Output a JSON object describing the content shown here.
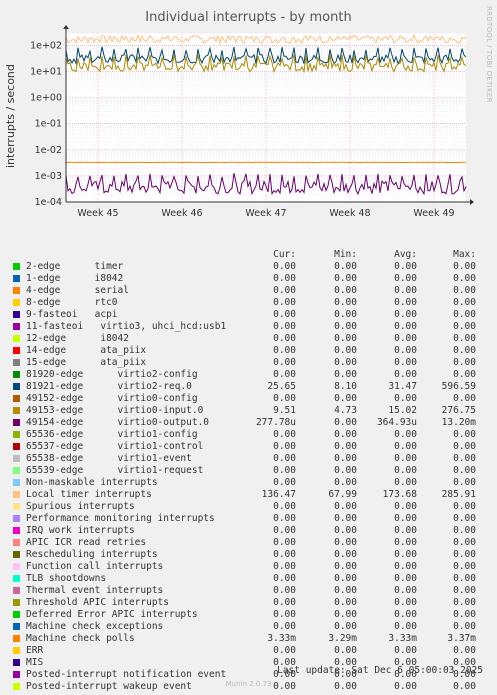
{
  "title": "Individual interrupts - by month",
  "side_label": "RRDTOOL / TOBI OETIKER",
  "colors": {
    "background": "#f0f0f0",
    "plot_bg": "#ffffff",
    "grid_major": "#e6a0a0",
    "grid_minor": "#d8d8f0"
  },
  "chart_data": {
    "type": "line",
    "ylabel": "interrupts / second",
    "yscale": "log",
    "ylim": [
      0.0001,
      300
    ],
    "yticks": [
      "1e+02",
      "1e+01",
      "1e+00",
      "1e-01",
      "1e-02",
      "1e-03",
      "1e-04"
    ],
    "xticks": [
      "Week 45",
      "Week 46",
      "Week 47",
      "Week 48",
      "Week 49"
    ],
    "series": [
      {
        "name": "Local timer interrupts",
        "color": "#ffc080",
        "base": 170,
        "spread": 0.3,
        "spike": 250
      },
      {
        "name": "49154-edge",
        "color": "#660066",
        "base": 0.000365,
        "spread": 0.5,
        "spike": 0.0013
      },
      {
        "name": "81921-edge",
        "color": "#004466",
        "base": 30,
        "spread": 0.35,
        "spike": 90
      },
      {
        "name": "49153-edge",
        "color": "#aa8800",
        "base": 15,
        "spread": 0.35,
        "spike": 45
      },
      {
        "name": "Machine check polls",
        "color": "#ee8800",
        "base": 0.0033,
        "spread": 0.01,
        "spike": 0.0034
      }
    ]
  },
  "legend": {
    "headers": [
      "Cur:",
      "Min:",
      "Avg:",
      "Max:"
    ],
    "rows": [
      {
        "name": "2-edge      timer",
        "color": "#00cc00",
        "cur": "0.00",
        "min": "0.00",
        "avg": "0.00",
        "max": "0.00"
      },
      {
        "name": "1-edge      i8042",
        "color": "#0066b3",
        "cur": "0.00",
        "min": "0.00",
        "avg": "0.00",
        "max": "0.00"
      },
      {
        "name": "4-edge      serial",
        "color": "#ff8000",
        "cur": "0.00",
        "min": "0.00",
        "avg": "0.00",
        "max": "0.00"
      },
      {
        "name": "8-edge      rtc0",
        "color": "#ffcc00",
        "cur": "0.00",
        "min": "0.00",
        "avg": "0.00",
        "max": "0.00"
      },
      {
        "name": "9-fasteoi   acpi",
        "color": "#330099",
        "cur": "0.00",
        "min": "0.00",
        "avg": "0.00",
        "max": "0.00"
      },
      {
        "name": "11-fasteoi   virtio3, uhci_hcd:usb1",
        "color": "#990099",
        "cur": "0.00",
        "min": "0.00",
        "avg": "0.00",
        "max": "0.00"
      },
      {
        "name": "12-edge      i8042",
        "color": "#ccff00",
        "cur": "0.00",
        "min": "0.00",
        "avg": "0.00",
        "max": "0.00"
      },
      {
        "name": "14-edge      ata_piix",
        "color": "#ff0000",
        "cur": "0.00",
        "min": "0.00",
        "avg": "0.00",
        "max": "0.00"
      },
      {
        "name": "15-edge      ata_piix",
        "color": "#808080",
        "cur": "0.00",
        "min": "0.00",
        "avg": "0.00",
        "max": "0.00"
      },
      {
        "name": "81920-edge      virtio2-config",
        "color": "#008f00",
        "cur": "0.00",
        "min": "0.00",
        "avg": "0.00",
        "max": "0.00"
      },
      {
        "name": "81921-edge      virtio2-req.0",
        "color": "#00487d",
        "cur": "25.65",
        "min": "8.10",
        "avg": "31.47",
        "max": "596.59"
      },
      {
        "name": "49152-edge      virtio0-config",
        "color": "#b35a00",
        "cur": "0.00",
        "min": "0.00",
        "avg": "0.00",
        "max": "0.00"
      },
      {
        "name": "49153-edge      virtio0-input.0",
        "color": "#b38f00",
        "cur": "9.51",
        "min": "4.73",
        "avg": "15.02",
        "max": "276.75"
      },
      {
        "name": "49154-edge      virtio0-output.0",
        "color": "#6b006b",
        "cur": "277.78u",
        "min": "0.00",
        "avg": "364.93u",
        "max": "13.20m"
      },
      {
        "name": "65536-edge      virtio1-config",
        "color": "#8fb300",
        "cur": "0.00",
        "min": "0.00",
        "avg": "0.00",
        "max": "0.00"
      },
      {
        "name": "65537-edge      virtio1-control",
        "color": "#b30000",
        "cur": "0.00",
        "min": "0.00",
        "avg": "0.00",
        "max": "0.00"
      },
      {
        "name": "65538-edge      virtio1-event",
        "color": "#bebebe",
        "cur": "0.00",
        "min": "0.00",
        "avg": "0.00",
        "max": "0.00"
      },
      {
        "name": "65539-edge      virtio1-request",
        "color": "#80ff80",
        "cur": "0.00",
        "min": "0.00",
        "avg": "0.00",
        "max": "0.00"
      },
      {
        "name": "Non-maskable interrupts",
        "color": "#80c9ff",
        "cur": "0.00",
        "min": "0.00",
        "avg": "0.00",
        "max": "0.00"
      },
      {
        "name": "Local timer interrupts",
        "color": "#ffc080",
        "cur": "136.47",
        "min": "67.99",
        "avg": "173.68",
        "max": "285.91"
      },
      {
        "name": "Spurious interrupts",
        "color": "#ffe680",
        "cur": "0.00",
        "min": "0.00",
        "avg": "0.00",
        "max": "0.00"
      },
      {
        "name": "Performance monitoring interrupts",
        "color": "#aa80ff",
        "cur": "0.00",
        "min": "0.00",
        "avg": "0.00",
        "max": "0.00"
      },
      {
        "name": "IRQ work interrupts",
        "color": "#ee00cc",
        "cur": "0.00",
        "min": "0.00",
        "avg": "0.00",
        "max": "0.00"
      },
      {
        "name": "APIC ICR read retries",
        "color": "#ff8080",
        "cur": "0.00",
        "min": "0.00",
        "avg": "0.00",
        "max": "0.00"
      },
      {
        "name": "Rescheduling interrupts",
        "color": "#666600",
        "cur": "0.00",
        "min": "0.00",
        "avg": "0.00",
        "max": "0.00"
      },
      {
        "name": "Function call interrupts",
        "color": "#ffbfff",
        "cur": "0.00",
        "min": "0.00",
        "avg": "0.00",
        "max": "0.00"
      },
      {
        "name": "TLB shootdowns",
        "color": "#00ffcc",
        "cur": "0.00",
        "min": "0.00",
        "avg": "0.00",
        "max": "0.00"
      },
      {
        "name": "Thermal event interrupts",
        "color": "#cc6699",
        "cur": "0.00",
        "min": "0.00",
        "avg": "0.00",
        "max": "0.00"
      },
      {
        "name": "Threshold APIC interrupts",
        "color": "#999900",
        "cur": "0.00",
        "min": "0.00",
        "avg": "0.00",
        "max": "0.00"
      },
      {
        "name": "Deferred Error APIC interrupts",
        "color": "#00cc00",
        "cur": "0.00",
        "min": "0.00",
        "avg": "0.00",
        "max": "0.00"
      },
      {
        "name": "Machine check exceptions",
        "color": "#0066b3",
        "cur": "0.00",
        "min": "0.00",
        "avg": "0.00",
        "max": "0.00"
      },
      {
        "name": "Machine check polls",
        "color": "#ff8000",
        "cur": "3.33m",
        "min": "3.29m",
        "avg": "3.33m",
        "max": "3.37m"
      },
      {
        "name": "ERR",
        "color": "#ffcc00",
        "cur": "0.00",
        "min": "0.00",
        "avg": "0.00",
        "max": "0.00"
      },
      {
        "name": "MIS",
        "color": "#330099",
        "cur": "0.00",
        "min": "0.00",
        "avg": "0.00",
        "max": "0.00"
      },
      {
        "name": "Posted-interrupt notification event",
        "color": "#990099",
        "cur": "0.00",
        "min": "0.00",
        "avg": "0.00",
        "max": "0.00"
      },
      {
        "name": "Posted-interrupt wakeup event",
        "color": "#ccff00",
        "cur": "0.00",
        "min": "0.00",
        "avg": "0.00",
        "max": "0.00"
      }
    ]
  },
  "last_update": "Last update: Sat Dec  6 05:00:03 2025",
  "footer": "Munin 2.0.73"
}
